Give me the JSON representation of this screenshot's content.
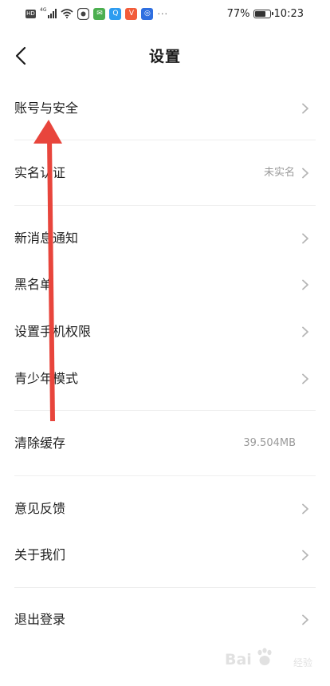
{
  "status_bar": {
    "net_hd": "HD",
    "net_4g": "4G",
    "battery_percent": "77%",
    "battery_level": 0.77,
    "time": "10:23",
    "more": "···",
    "app_icons": [
      {
        "name": "message-app-icon",
        "color": "#4caf50",
        "glyph": "✉"
      },
      {
        "name": "search-app-icon",
        "color": "#2d9cf0",
        "glyph": "Q"
      },
      {
        "name": "v-app-icon",
        "color": "#f25c3a",
        "glyph": "V"
      },
      {
        "name": "bulb-app-icon",
        "color": "#2f6fe0",
        "glyph": "◎"
      }
    ]
  },
  "header": {
    "title": "设置",
    "back_icon": "chevron-left-icon"
  },
  "settings": {
    "groups": [
      {
        "items": [
          {
            "label": "账号与安全",
            "value": "",
            "chevron": true
          }
        ]
      },
      {
        "items": [
          {
            "label": "实名认证",
            "value": "未实名",
            "chevron": true
          }
        ]
      },
      {
        "items": [
          {
            "label": "新消息通知",
            "value": "",
            "chevron": true
          },
          {
            "label": "黑名单",
            "value": "",
            "chevron": true
          },
          {
            "label": "设置手机权限",
            "value": "",
            "chevron": true
          },
          {
            "label": "青少年模式",
            "value": "",
            "chevron": true
          }
        ]
      },
      {
        "items": [
          {
            "label": "清除缓存",
            "value": "39.504MB",
            "chevron": false
          }
        ]
      },
      {
        "items": [
          {
            "label": "意见反馈",
            "value": "",
            "chevron": true
          },
          {
            "label": "关于我们",
            "value": "",
            "chevron": true
          }
        ]
      },
      {
        "items": [
          {
            "label": "退出登录",
            "value": "",
            "chevron": true
          }
        ]
      }
    ]
  },
  "annotation": {
    "arrow_color": "#e8453c"
  },
  "watermark": {
    "text": "Bai",
    "sub": "经验"
  },
  "colors": {
    "chevron": "#b5b5b5",
    "divider": "#eeeeee",
    "value_text": "#9a9a9a"
  }
}
